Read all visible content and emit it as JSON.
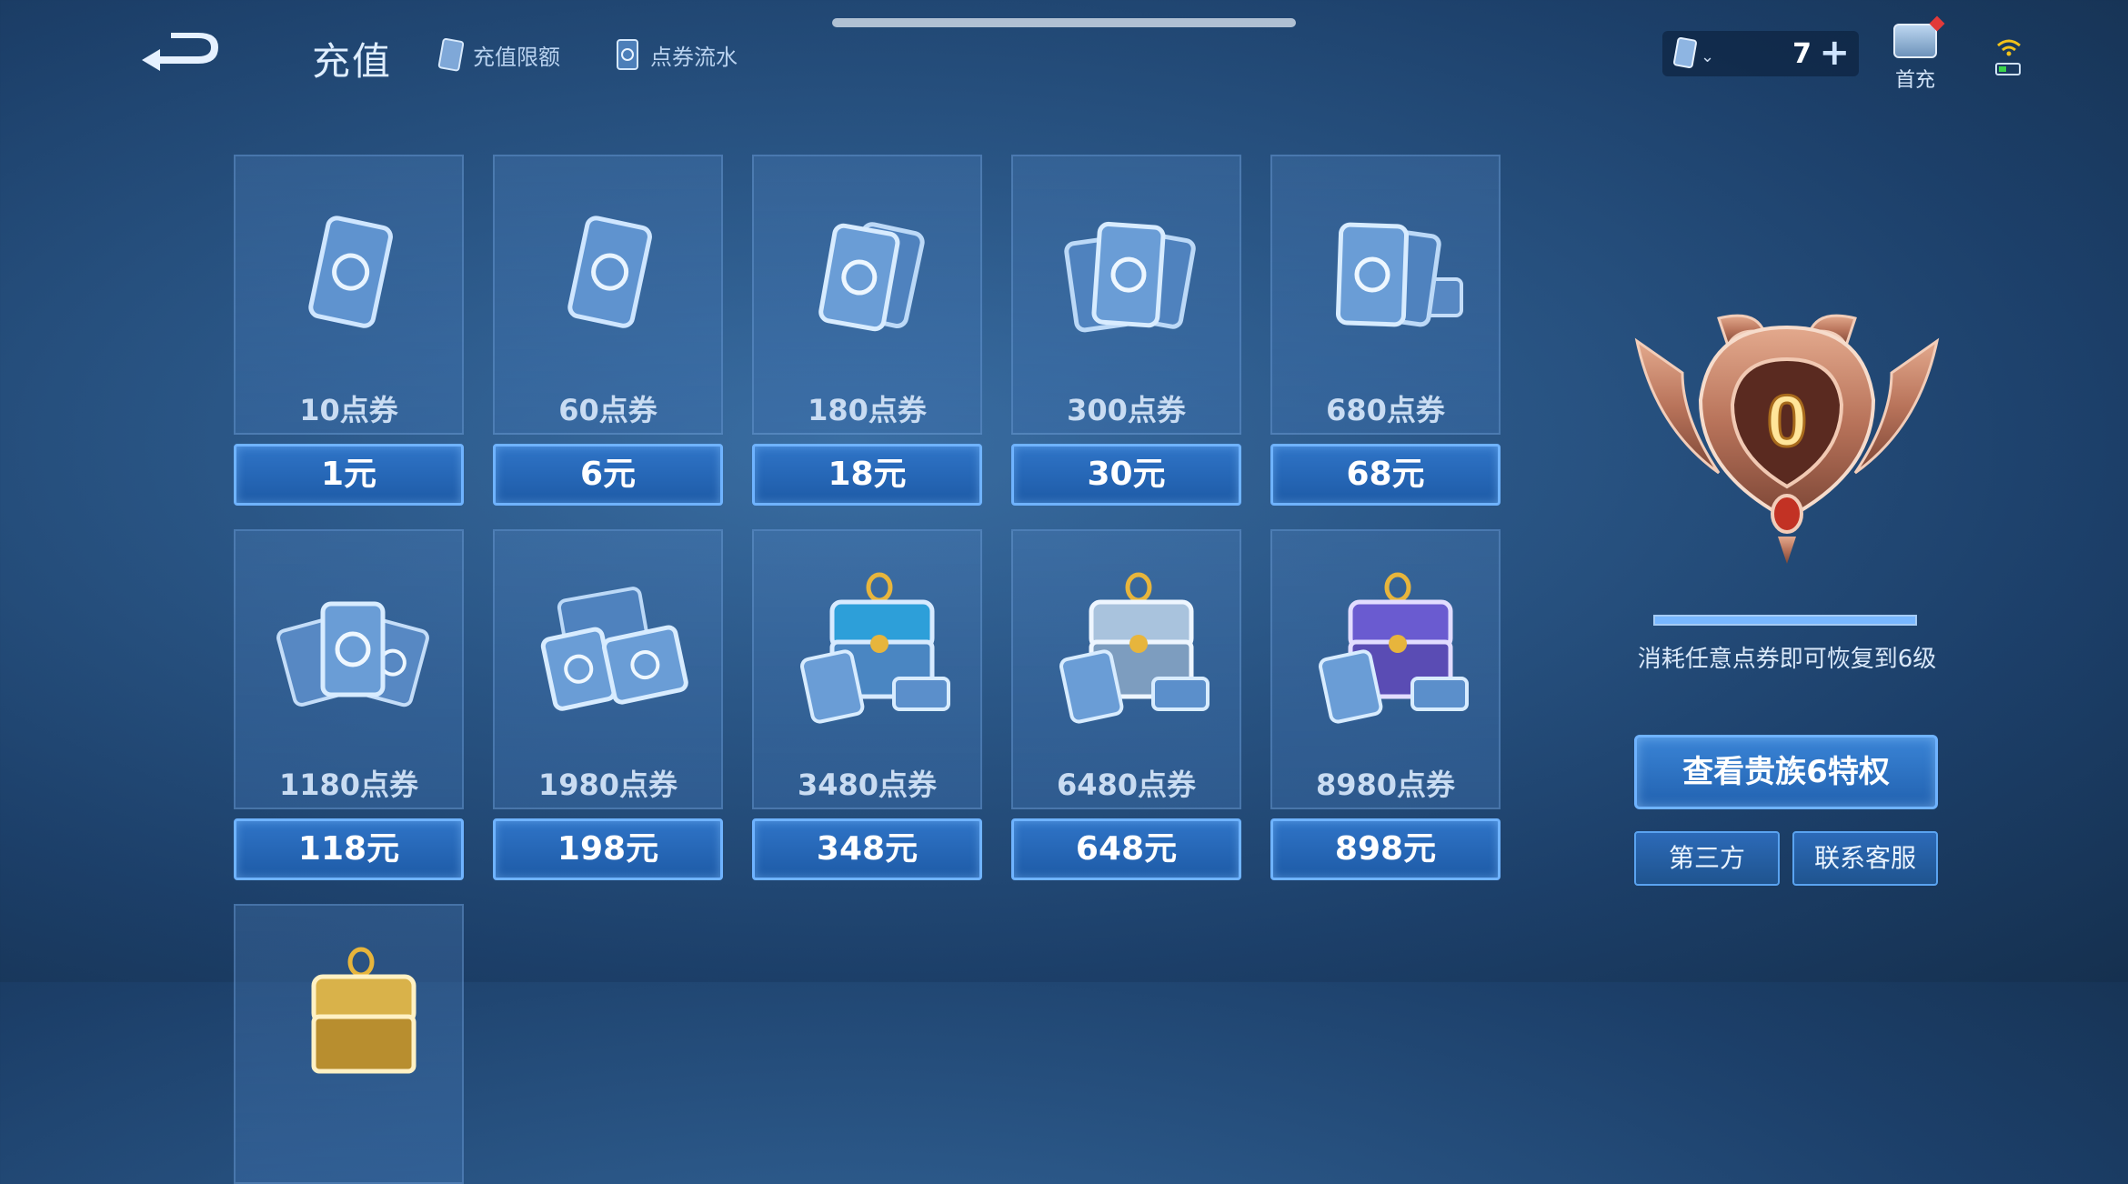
{
  "header": {
    "title": "充值",
    "links": [
      {
        "label": "充值限额",
        "icon": "voucher-icon"
      },
      {
        "label": "点券流水",
        "icon": "voucher-record-icon"
      }
    ]
  },
  "currency": {
    "value": "7",
    "icon": "voucher-icon",
    "add_icon": "plus-icon"
  },
  "first_charge": {
    "label": "首充"
  },
  "items": [
    {
      "amount": "10点券",
      "price": "1元",
      "art": "voucher-single"
    },
    {
      "amount": "60点券",
      "price": "6元",
      "art": "voucher-single"
    },
    {
      "amount": "180点券",
      "price": "18元",
      "art": "voucher-double"
    },
    {
      "amount": "300点券",
      "price": "30元",
      "art": "voucher-triple"
    },
    {
      "amount": "680点券",
      "price": "68元",
      "art": "voucher-stack"
    },
    {
      "amount": "1180点券",
      "price": "118元",
      "art": "voucher-pile"
    },
    {
      "amount": "1980点券",
      "price": "198元",
      "art": "voucher-bigpile"
    },
    {
      "amount": "3480点券",
      "price": "348元",
      "art": "chest-blue"
    },
    {
      "amount": "6480点券",
      "price": "648元",
      "art": "chest-silver"
    },
    {
      "amount": "8980点券",
      "price": "898元",
      "art": "chest-purple"
    },
    {
      "amount": "",
      "price": "",
      "art": "chest-gold"
    }
  ],
  "noble": {
    "level": "0",
    "progress": 1.0,
    "description": "消耗任意点券即可恢复到6级",
    "privilege_button": "查看贵族6特权",
    "third_party_button": "第三方",
    "support_button": "联系客服"
  },
  "colors": {
    "accent": "#6fb3ff",
    "price_button": "#2f74c7",
    "badge": "#b8735a"
  }
}
